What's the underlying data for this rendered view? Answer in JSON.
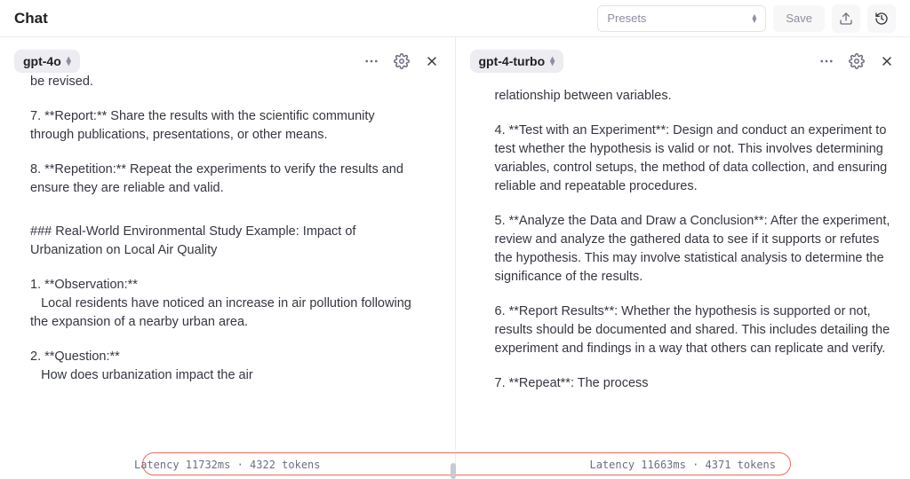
{
  "header": {
    "title": "Chat",
    "presets_placeholder": "Presets",
    "save_label": "Save"
  },
  "left": {
    "model": "gpt-4o",
    "p_frag0": "be revised.",
    "p7": "7. **Report:** Share the results with the scientific community through publications, presentations, or other means.",
    "p8": "8. **Repetition:** Repeat the experiments to verify the results and ensure they are reliable and valid.",
    "h3": "### Real-World Environmental Study Example: Impact of Urbanization on Local Air Quality",
    "obs_t": "1. **Observation:**",
    "obs_b": "   Local residents have noticed an increase in air pollution following the expansion of a nearby urban area.",
    "q_t": "2. **Question:**",
    "q_b": "   How does urbanization impact the air",
    "latency_ms": 11732,
    "tokens": 4322
  },
  "right": {
    "model": "gpt-4-turbo",
    "p_frag0": "relationship between variables.",
    "p4": "4. **Test with an Experiment**: Design and conduct an experiment to test whether the hypothesis is valid or not. This involves determining variables, control setups, the method of data collection, and ensuring reliable and repeatable procedures.",
    "p5": "5. **Analyze the Data and Draw a Conclusion**: After the experiment, review and analyze the gathered data to see if it supports or refutes the hypothesis. This may involve statistical analysis to determine the significance of the results.",
    "p6": "6. **Report Results**: Whether the hypothesis is supported or not, results should be documented and shared. This includes detailing the experiment and findings in a way that others can replicate and verify.",
    "p7": "7. **Repeat**: The process",
    "latency_ms": 11663,
    "tokens": 4371
  },
  "footer": {
    "left_metrics": "Latency 11732ms · 4322 tokens",
    "right_metrics": "Latency 11663ms · 4371 tokens"
  }
}
